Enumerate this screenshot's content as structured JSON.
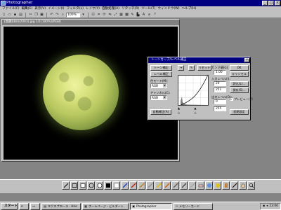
{
  "app": {
    "title": "Photographer"
  },
  "menubar": {
    "items": [
      "ファイル(F)",
      "編集(E)",
      "表示(V)",
      "イメージ(I)",
      "フィルタ(L)",
      "レイヤ(Y)",
      "自動処理(A)",
      "リタッチ(R)",
      "ツール(T)",
      "ウィンドウ(W)",
      "ヘルプ(H)"
    ]
  },
  "toolbar": {
    "zoom_value": "100%"
  },
  "document": {
    "title": "[無題](8/4/2003).jpg 1/1(100%)(RGB)"
  },
  "dialog": {
    "title": "トーンカーブ/レベル補正",
    "tab_curve": "トーン補正",
    "tab_level": "レベル補正",
    "toolbtns": [
      "→",
      "✎",
      "リセット"
    ],
    "channel_label": "色モード(M):",
    "channel_value": "RGB",
    "channel2_label": "チャンネル(C):",
    "channel2_value": "RGB",
    "auto_button": "自動補正(A)",
    "gamma_label": "ガンマ値(G):",
    "gamma_value": "1.00",
    "input_label": "入力レベル(I):",
    "input_low": "20",
    "input_high": "251",
    "output_label": "出力レベル(O):",
    "output_low": "0",
    "output_high": "255",
    "ok_button": "OK",
    "cancel_button": "キャンセル",
    "load_button": "読込(L)...",
    "save_button": "保存(S)...",
    "preview_label": "プレビュー(P)",
    "init_button": "初期設定"
  },
  "palette": {
    "colors": [
      "#000000",
      "#ffffff",
      "#ff0000",
      "#00a000",
      "#0000ff",
      "#ffff00",
      "#c0c0c0",
      "#800080"
    ]
  },
  "taskbar": {
    "start": "スタート",
    "items": [
      "エクスプローラ - Hiro",
      "ホームページ・ビルダート",
      "Photographer",
      "メモリーカード"
    ],
    "clock": "23:00"
  }
}
